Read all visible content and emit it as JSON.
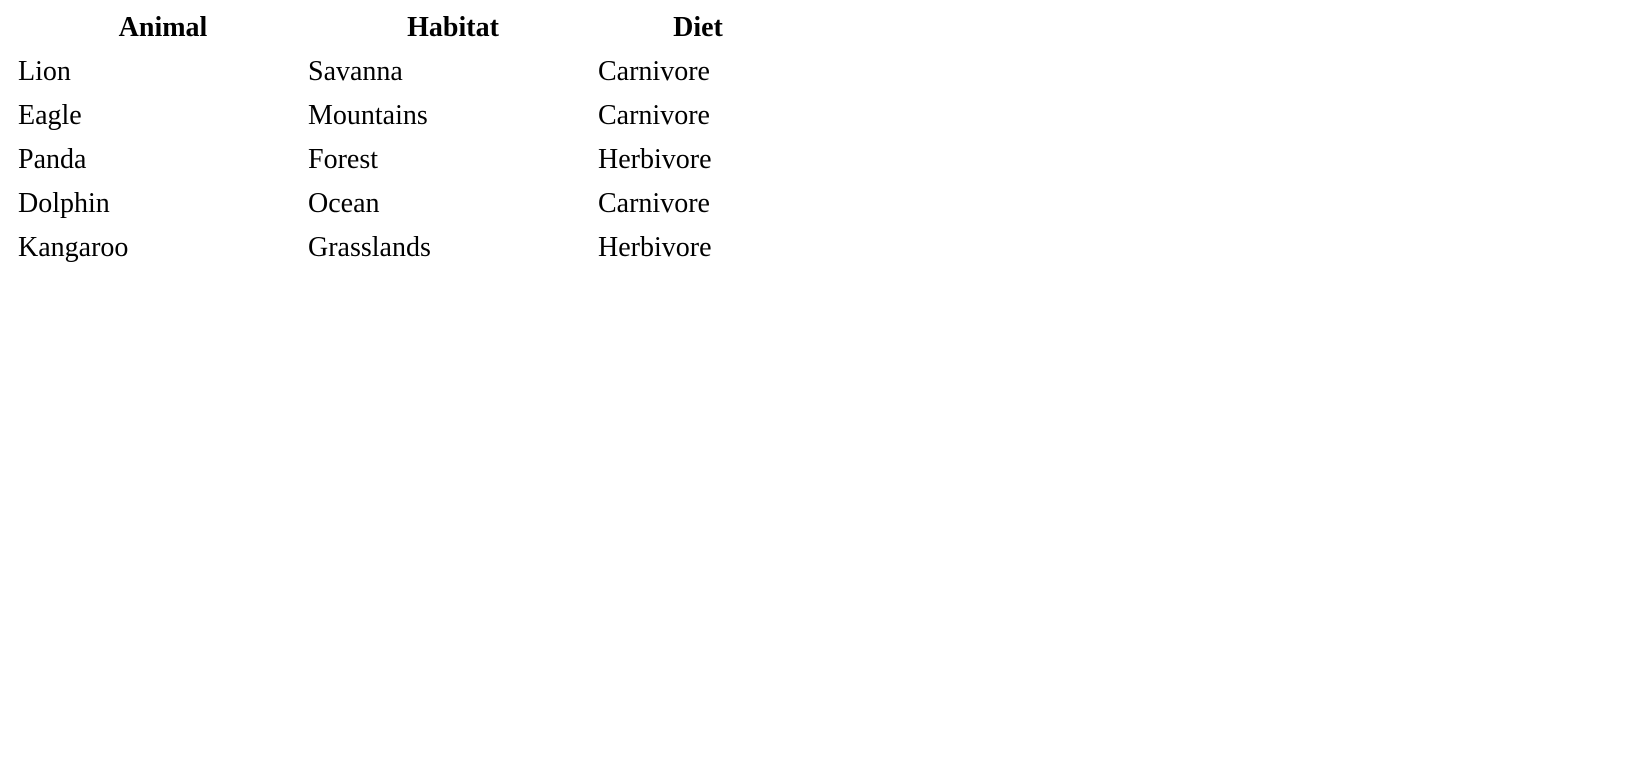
{
  "chart_data": {
    "type": "table",
    "headers": [
      "Animal",
      "Habitat",
      "Diet"
    ],
    "rows": [
      [
        "Lion",
        "Savanna",
        "Carnivore"
      ],
      [
        "Eagle",
        "Mountains",
        "Carnivore"
      ],
      [
        "Panda",
        "Forest",
        "Herbivore"
      ],
      [
        "Dolphin",
        "Ocean",
        "Carnivore"
      ],
      [
        "Kangaroo",
        "Grasslands",
        "Herbivore"
      ]
    ]
  }
}
